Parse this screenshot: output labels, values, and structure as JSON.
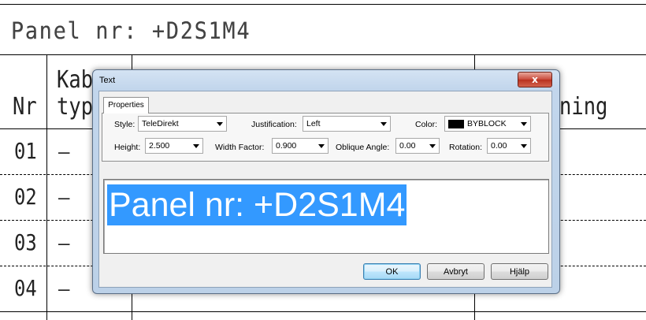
{
  "drawing": {
    "title": "Panel nr: +D2S1M4",
    "header_nr": "Nr",
    "header_kab_line1": "Kab",
    "header_kab_line2": "typ",
    "header_right": "ning",
    "rows": [
      {
        "nr": "01",
        "value": "–"
      },
      {
        "nr": "02",
        "value": "–"
      },
      {
        "nr": "03",
        "value": "–"
      },
      {
        "nr": "04",
        "value": "–"
      }
    ]
  },
  "dialog": {
    "title": "Text",
    "close_label": "x",
    "tab_label": "Properties",
    "style_label": "Style:",
    "style_value": "TeleDirekt",
    "justification_label": "Justification:",
    "justification_value": "Left",
    "color_label": "Color:",
    "color_value": "BYBLOCK",
    "height_label": "Height:",
    "height_value": "2.500",
    "width_factor_label": "Width Factor:",
    "width_factor_value": "0.900",
    "oblique_label": "Oblique Angle:",
    "oblique_value": "0.00",
    "rotation_label": "Rotation:",
    "rotation_value": "0.00",
    "text_content": "Panel nr: +D2S1M4",
    "ok_label": "OK",
    "cancel_label": "Avbryt",
    "help_label": "Hjälp",
    "selection_color": "#3399ff"
  }
}
